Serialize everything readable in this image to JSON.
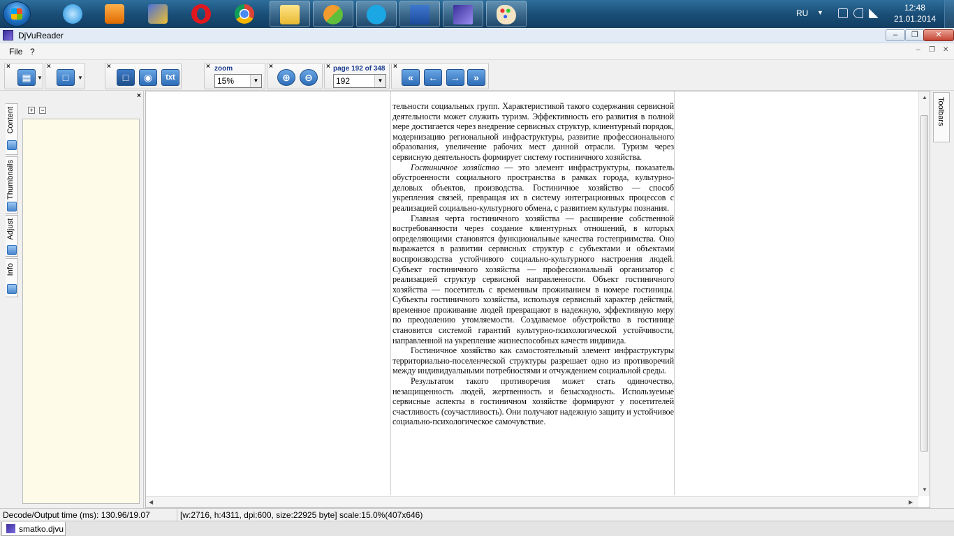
{
  "taskbar": {
    "apps": [
      {
        "name": "Internet Explorer",
        "icon": "ie-icon"
      },
      {
        "name": "Media Player",
        "icon": "media-player-icon"
      },
      {
        "name": "Tools",
        "icon": "tools-icon"
      },
      {
        "name": "Opera",
        "icon": "opera-icon"
      },
      {
        "name": "Chrome",
        "icon": "chrome-icon"
      },
      {
        "name": "Explorer",
        "icon": "folder-icon"
      },
      {
        "name": "App",
        "icon": "app-icon"
      },
      {
        "name": "Skype",
        "icon": "skype-icon"
      },
      {
        "name": "Word",
        "icon": "word-icon"
      },
      {
        "name": "DjVuReader",
        "icon": "djvu-icon"
      },
      {
        "name": "Paint",
        "icon": "paint-icon"
      }
    ],
    "language": "RU",
    "time": "12:48",
    "date": "21.01.2014"
  },
  "window": {
    "title": "DjVuReader",
    "minimize": "–",
    "maximize": "❐",
    "close": "✕"
  },
  "menu": {
    "file": "File",
    "help": "?",
    "mdi_minimize": "–",
    "mdi_restore": "❐",
    "mdi_close": "✕"
  },
  "toolbar": {
    "close_glyph": "×",
    "text_button": "txt",
    "zoom_label": "zoom",
    "zoom_value": "15%",
    "page_label": "page 192 of 348",
    "page_value": "192",
    "zoom_in": "⊕",
    "zoom_out": "⊖",
    "first_page": "«",
    "prev_page": "←",
    "next_page": "→",
    "last_page": "»"
  },
  "side_tabs": {
    "content": "Content",
    "thumbnails": "Thumbnails",
    "adjust": "Adjust",
    "info": "Info"
  },
  "tree": {
    "expand": "+",
    "collapse": "−"
  },
  "document": {
    "paragraphs": [
      {
        "lead": "",
        "text": "тельности социальных групп. Характеристикой такого содержания сервисной деятельности может служить туризм. Эффективность его развития в полной мере достигается через внедрение сервисных структур, клиентурный порядок, модернизацию региональной инфраструктуры, развитие профессионального образования, увеличение рабочих мест данной отрасли. Туризм через сервисную деятельность формирует систему гостиничного хозяйства."
      },
      {
        "lead": "Гостиничное хозяйство",
        "text": " — это элемент инфраструктуры, показатель обустроенности социального пространства в рамках города, культурно-деловых объектов, производства. Гостиничное хозяйство — способ укрепления связей, превращая их в систему интеграционных процессов с реализацией социально-культурного обмена, с развитием культуры познания."
      },
      {
        "lead": "",
        "text": "Главная черта гостиничного хозяйства — расширение собственной востребованности через создание клиентурных отношений, в которых определяющими становятся функциональные качества гостеприимства. Оно выражается в развитии сервисных структур с субъектами и объектами воспроизводства устойчивого социально-культурного настроения людей. Субъект гостиничного хозяйства — профессиональный организатор с реализацией структур сервисной направленности. Объект гостиничного хозяйства — посетитель с временным проживанием в номере гостиницы. Субъекты гостиничного хозяйства, используя сервисный характер действий, временное проживание людей превращают в надежную, эффективную меру по преодолению утомляемости. Создаваемое обустройство в гостинице становится системой гарантий культурно-психологической устойчивости, направленной на укрепление жизнеспособных качеств индивида."
      },
      {
        "lead": "",
        "text": "Гостиничное хозяйство как самостоятельный элемент инфраструктуры территориально-поселенческой структуры разрешает одно из противоречий между индивидуальными потребностями и отчуждением социальной среды."
      },
      {
        "lead": "",
        "text": "Результатом такого противоречия может стать одиночество, незащищенность людей, жертвенность и безысходность. Используемые сервисные аспекты в гостиничном хозяйстве формируют у посетителей счастливость (соучастливость). Они получают надежную защиту и устойчивое социально-психологическое самочувствие."
      }
    ]
  },
  "right_panel": {
    "toolbars_label": "Toolbars"
  },
  "status": {
    "decode_time": "Decode/Output time (ms): 130.96/19.07",
    "page_info": "[w:2716, h:4311, dpi:600, size:22925 byte] scale:15.0%(407x646)"
  },
  "doc_tab": {
    "filename": "smatko.djvu"
  },
  "colors": {
    "accent": "#2d6db8",
    "panel_background": "#fffbe9",
    "taskbar": "#1a4f78"
  }
}
